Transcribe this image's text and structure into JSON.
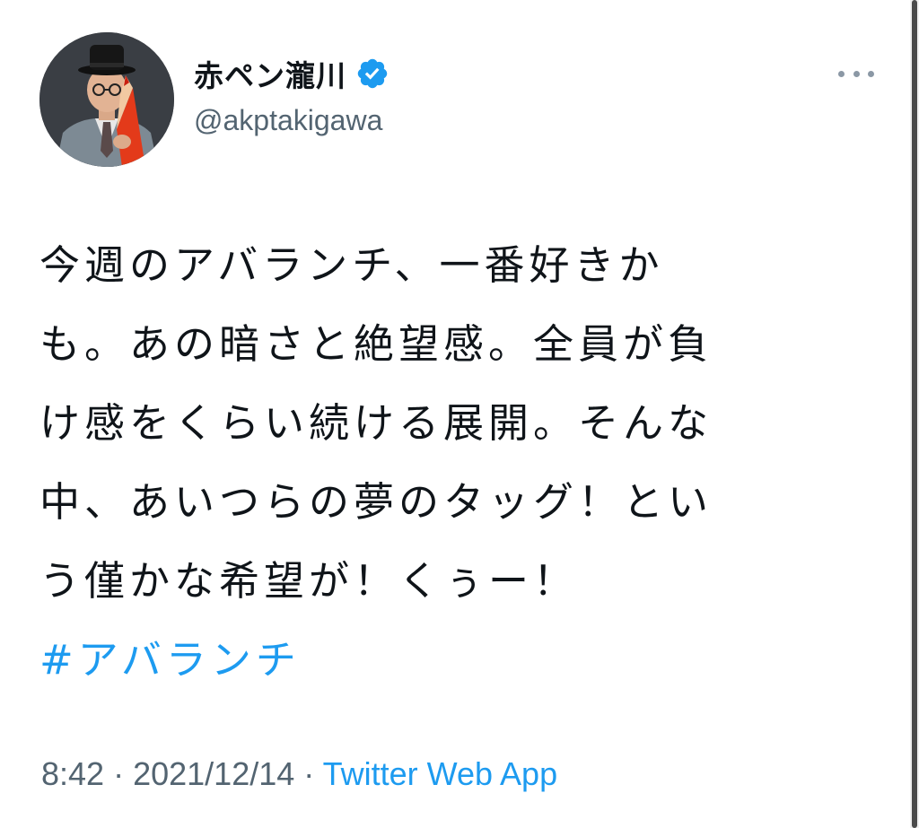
{
  "tweet": {
    "author": {
      "display_name": "赤ペン瀧川",
      "handle": "@akptakigawa",
      "verified": true,
      "verified_icon": "verified-badge-icon",
      "avatar_icon": "profile-photo"
    },
    "more_icon": "more-options-icon",
    "text_lines": [
      "今週のアバランチ、一番好きか",
      "も。あの暗さと絶望感。全員が負",
      "け感をくらい続ける展開。そんな",
      "中、あいつらの夢のタッグ！とい",
      "う僅かな希望が！くぅー！"
    ],
    "hashtag": "#アバランチ",
    "time": "8:42",
    "separator": "·",
    "date": "2021/12/14",
    "source": "Twitter Web App"
  },
  "colors": {
    "accent": "#1d9bf0",
    "text": "#0f1419",
    "secondary": "#536471"
  }
}
